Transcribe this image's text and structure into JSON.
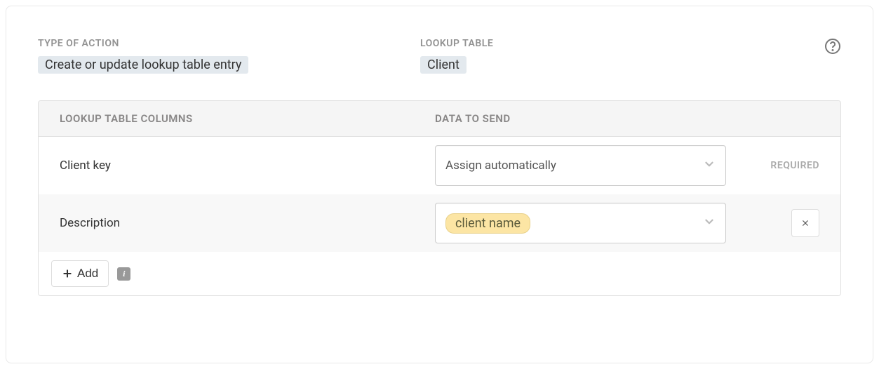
{
  "header": {
    "type_of_action_label": "TYPE OF ACTION",
    "type_of_action_value": "Create or update lookup table entry",
    "lookup_table_label": "LOOKUP TABLE",
    "lookup_table_value": "Client"
  },
  "table": {
    "columns_header": "LOOKUP TABLE COLUMNS",
    "data_header": "DATA TO SEND",
    "rows": [
      {
        "label": "Client key",
        "value": "Assign automatically",
        "required_text": "REQUIRED"
      },
      {
        "label": "Description",
        "tag": "client name"
      }
    ],
    "add_button": "Add"
  }
}
